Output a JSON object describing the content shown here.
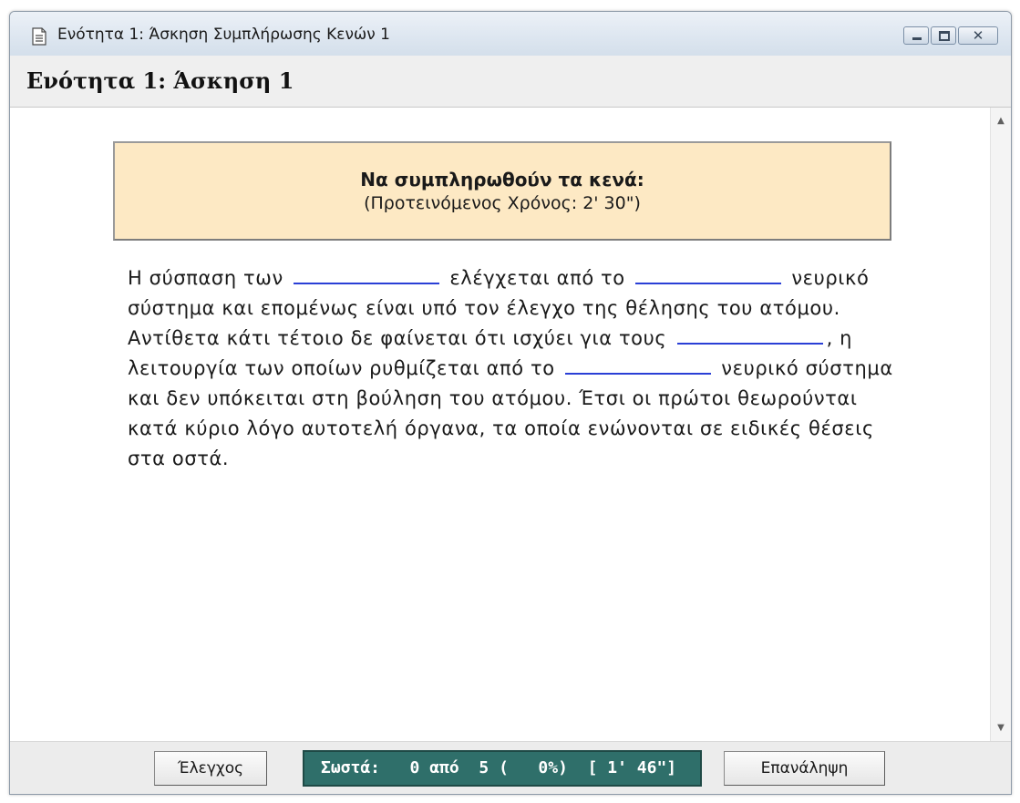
{
  "window": {
    "title": "Ενότητα 1: Άσκηση Συμπλήρωσης Κενών 1"
  },
  "header": {
    "heading": "Ενότητα 1: Άσκηση 1"
  },
  "instructions": {
    "title": "Να συμπληρωθούν τα κενά:",
    "subtitle": "(Προτεινόμενος Χρόνος: 2' 30\")"
  },
  "exercise": {
    "segments": [
      "Η σύσπαση των",
      "ελέγχεται από το",
      "νευρικό σύστημα και επομένως είναι υπό τον έλεγχο της θέλησης του ατόμου. Αντίθετα κάτι τέτοιο δε φαίνεται ότι ισχύει για τους",
      ", η λειτουργία των οποίων ρυθμίζεται από το",
      "νευρικό σύστημα και δεν υπόκειται στη βούληση του ατόμου. Έτσι οι πρώτοι θεωρούνται κατά κύριο λόγο αυτοτελή όργανα, τα οποία ενώνονται σε ειδικές θέσεις στα οστά."
    ],
    "blanks": [
      "",
      "",
      "",
      ""
    ]
  },
  "footer": {
    "check_label": "Έλεγχος",
    "score_text": "Σωστά:   0 από  5 (   0%)  [ 1' 46\"]",
    "repeat_label": "Επανάληψη"
  },
  "colors": {
    "instruction_bg": "#fde9c4",
    "blank_underline": "#2a3fd6",
    "score_bg": "#2f6f6a"
  }
}
